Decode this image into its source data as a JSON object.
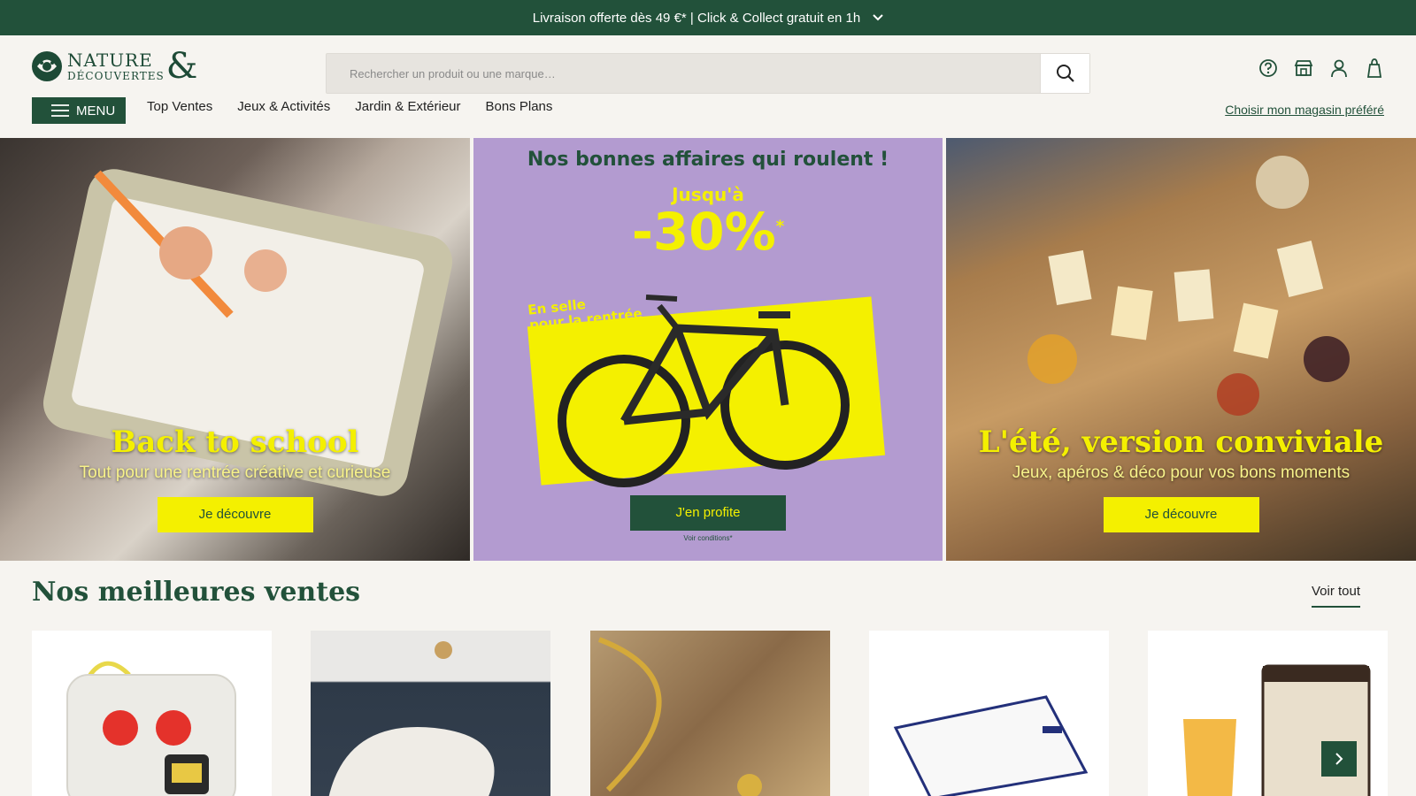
{
  "topbar": {
    "message": "Livraison offerte dès 49 €* | Click & Collect gratuit en 1h"
  },
  "header": {
    "logo_line1": "NATURE",
    "logo_line2": "DÉCOUVERTES",
    "logo_amp": "&",
    "search_placeholder": "Rechercher un produit ou une marque…",
    "menu_label": "MENU",
    "nav": [
      "Top Ventes",
      "Jeux & Activités",
      "Jardin & Extérieur",
      "Bons Plans"
    ],
    "store_link": "Choisir mon magasin préféré",
    "icons": [
      "help-icon",
      "store-icon",
      "account-icon",
      "cart-icon"
    ]
  },
  "banners": {
    "left": {
      "title": "Back to school",
      "subtitle": "Tout pour une rentrée créative et curieuse",
      "cta": "Je découvre"
    },
    "middle": {
      "headline": "Nos bonnes affaires qui roulent !",
      "upto": "Jusqu'à",
      "percent": "-30%",
      "asterisk": "*",
      "tag_line1": "En selle",
      "tag_line2": "pour la rentrée",
      "cta": "J'en profite",
      "conditions": "Voir conditions*"
    },
    "right": {
      "title": "L'été, version conviviale",
      "subtitle": "Jeux, apéros & déco pour vos bons moments",
      "cta": "Je découvre"
    }
  },
  "bestsellers": {
    "title": "Nos meilleures ventes",
    "see_all": "Voir tout"
  },
  "colors": {
    "brand_green": "#22513a",
    "accent_yellow": "#f4f000",
    "promo_purple": "#b39bd0"
  }
}
